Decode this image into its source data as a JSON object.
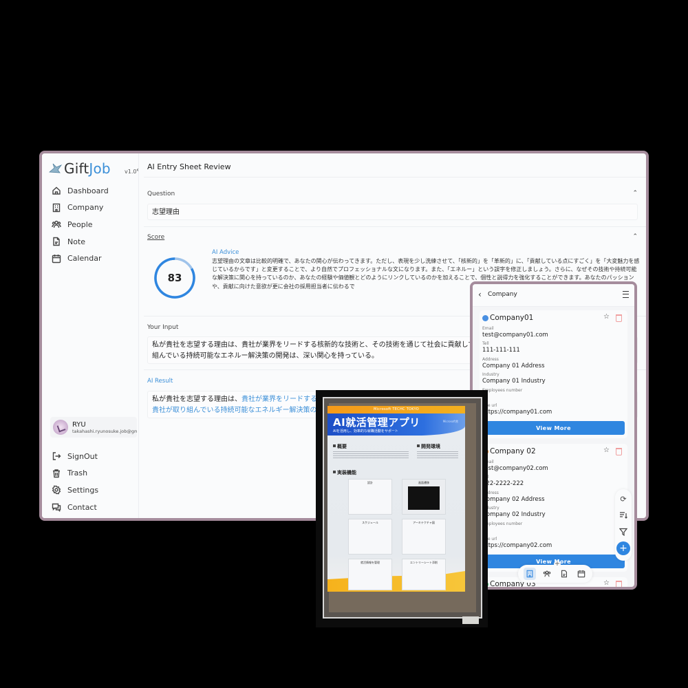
{
  "app": {
    "brand_prefix": "Gift",
    "brand_suffix": "Job",
    "version": "v1.0",
    "collapse_icon": "chevron-left-icon"
  },
  "sidebar": {
    "items": [
      {
        "label": "Dashboard",
        "icon": "home-icon"
      },
      {
        "label": "Company",
        "icon": "building-icon"
      },
      {
        "label": "People",
        "icon": "people-icon"
      },
      {
        "label": "Note",
        "icon": "note-icon"
      },
      {
        "label": "Calendar",
        "icon": "calendar-icon"
      }
    ],
    "user": {
      "name": "RYU",
      "email": "takahashi.ryunosuke.job@gmail.com"
    },
    "bottom_items": [
      {
        "label": "SignOut",
        "icon": "signout-icon"
      },
      {
        "label": "Trash",
        "icon": "trash-icon"
      },
      {
        "label": "Settings",
        "icon": "gear-icon"
      },
      {
        "label": "Contact",
        "icon": "chat-icon"
      }
    ]
  },
  "main": {
    "title": "AI Entry Sheet Review",
    "question": {
      "label": "Question",
      "value": "志望理由"
    },
    "score": {
      "label": "Score",
      "value": "83",
      "percent": 83,
      "advice_title": "AI Advice",
      "advice_text": "志望理由の文章は比較的明確で、あなたの関心が伝わってきます。ただし、表現を少し洗練させて、「核新的」を「革新的」に、「貢献している点にすごく」を「大変魅力を感じているからです」と変更することで、より自然でプロフェッショナルな文になります。また、「エネルー」という誤字を修正しましょう。さらに、なぜその技術や持続可能な解決策に関心を持っているのか、あなたの経験や価値観とどのようにリンクしているのかを加えることで、個性と説得力を強化することができます。あなたのパッションや、貢献に向けた意欲が更に会社の採用担当者に伝わるで"
    },
    "input": {
      "label": "Your Input",
      "line1": "私が貴社を志望する理由は、貴社が業界をリードする核新的な技術と、その技術を通じて社会に貢献してい",
      "line2": "組んでいる持続可能なエネルー解決策の開発は、深い関心を持っている。"
    },
    "result": {
      "label": "AI Result",
      "line1_plain": "私が貴社を志望する理由は、",
      "line1_highlight": "貴社が業界をリードする革",
      "line2_highlight": "貴社が取り組んでいる持続可能なエネルギー解決策の開"
    }
  },
  "mobile": {
    "header_title": "Company",
    "companies": [
      {
        "name": "Company01",
        "dot_color": "#4a90e2",
        "email_label": "Email",
        "email": "test@company01.com",
        "tel_label": "Tell",
        "tel": "111-111-111",
        "address_label": "Address",
        "address": "Company 01 Address",
        "industry_label": "Industry",
        "industry": "Company 01 Industry",
        "employees_label": "Employees number",
        "employees": "",
        "site_label": "Site url",
        "site": "https://company01.com",
        "button": "View More"
      },
      {
        "name": "Company 02",
        "dot_color": "#f08c2e",
        "email_label": "Email",
        "email": "test@company02.com",
        "tel_label": "Tell",
        "tel": "222-2222-222",
        "address_label": "Address",
        "address": "Company 02 Address",
        "industry_label": "Industry",
        "industry": "Company 02 Industry",
        "employees_label": "Employees number",
        "employees": "0",
        "site_label": "Site url",
        "site": "https://company02.com",
        "button": "View More"
      },
      {
        "name": "Company 03",
        "dot_color": "#3dbb6a"
      }
    ],
    "fab_icons": [
      "refresh-icon",
      "sort-icon",
      "filter-icon",
      "add-icon"
    ],
    "bottom_nav": [
      "building-icon",
      "people-icon",
      "note-icon",
      "calendar-icon"
    ]
  },
  "poster": {
    "top_banner": "Microsoft    TECHC TOKYO",
    "title": "AI就活管理アプリ",
    "subtitle": "AIを活用し、効率的な就職活動をサポート",
    "ms_label": "Microsoft賞",
    "section_overview": "概要",
    "section_env": "開発環境",
    "section_features": "実装機能",
    "panels": [
      "設計",
      "画面遷移",
      "スケジュール",
      "アーキテクチャ図",
      "就活情報を管理",
      "エントリーシート添削"
    ]
  },
  "colors": {
    "accent": "#3b8fd8",
    "button": "#2f86e0",
    "window_border": "#a58c9c",
    "trash": "#f0a0a0"
  }
}
